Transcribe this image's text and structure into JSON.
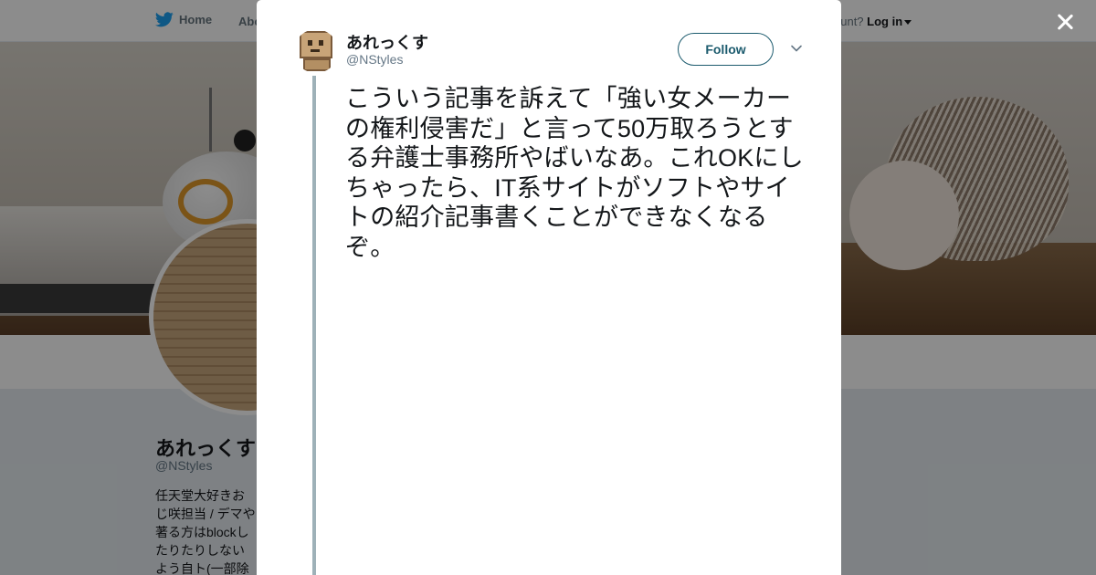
{
  "background": {
    "nav": {
      "home_label": "Home",
      "about_label": "Abo",
      "account_prompt": "ccount?",
      "login_label": "Log in"
    },
    "profile": {
      "name": "あれっくす",
      "handle": "@NStyles",
      "bio": "任天堂大好きおじ咲担当 / デマや著る方はblockしたりたりしないよう自ト(一部除く)への"
    }
  },
  "tweet": {
    "author_name": "あれっくす",
    "author_handle": "@NStyles",
    "follow_label": "Follow",
    "text": "こういう記事を訴えて「強い女メーカーの権利侵害だ」と言って50万取ろうとする弁護士事務所やばいなあ。これOKにしちゃったら、IT系サイトがソフトやサイトの紹介記事書くことができなくなるぞ。"
  },
  "icons": {
    "nav_home": "twitter-bird-icon",
    "close": "close-icon",
    "more": "chevron-down-icon"
  },
  "colors": {
    "brand_blue": "#1da1f2",
    "follow_accent": "#1c5b6e",
    "thread_line": "#9eb1b8"
  }
}
